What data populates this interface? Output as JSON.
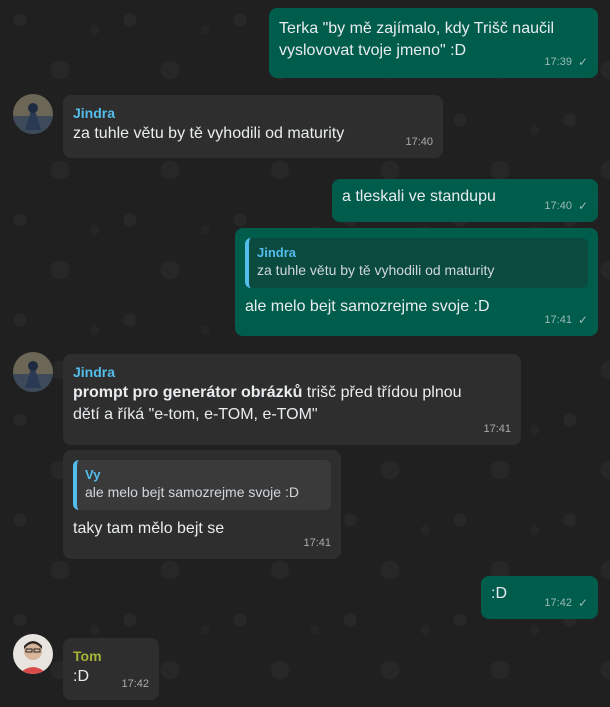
{
  "messages": {
    "m1": {
      "text_1": "Terka \"by mě zajímalo, kdy Trišč naučil",
      "text_2": "vyslovovat tvoje jmeno\" :D",
      "time": "17:39"
    },
    "m2": {
      "sender": "Jindra",
      "text": "za tuhle větu by tě vyhodili od maturity",
      "time": "17:40"
    },
    "m3": {
      "text": "a tleskali ve standupu",
      "time": "17:40"
    },
    "m4": {
      "quote_name": "Jindra",
      "quote_text": "za tuhle větu by tě vyhodili od maturity",
      "text": "ale melo bejt samozrejme svoje :D",
      "time": "17:41"
    },
    "m5": {
      "sender": "Jindra",
      "bold": "prompt pro generátor obrázků",
      "rest_1": " trišč před třídou plnou",
      "text_2": "dětí a říká \"e-tom, e-TOM, e-TOM\"",
      "time": "17:41"
    },
    "m6": {
      "quote_name": "Vy",
      "quote_text": "ale melo bejt samozrejme svoje :D",
      "text": "taky tam mělo bejt se",
      "time": "17:41"
    },
    "m7": {
      "text": ":D",
      "time": "17:42"
    },
    "m8": {
      "sender": "Tom",
      "text": ":D",
      "time": "17:42"
    }
  },
  "icons": {
    "read_check": "✓"
  },
  "colors": {
    "outgoing": "#005c4b",
    "incoming": "#2e2e2e",
    "sender_jindra": "#53bdeb",
    "sender_tom": "#a5b337"
  }
}
